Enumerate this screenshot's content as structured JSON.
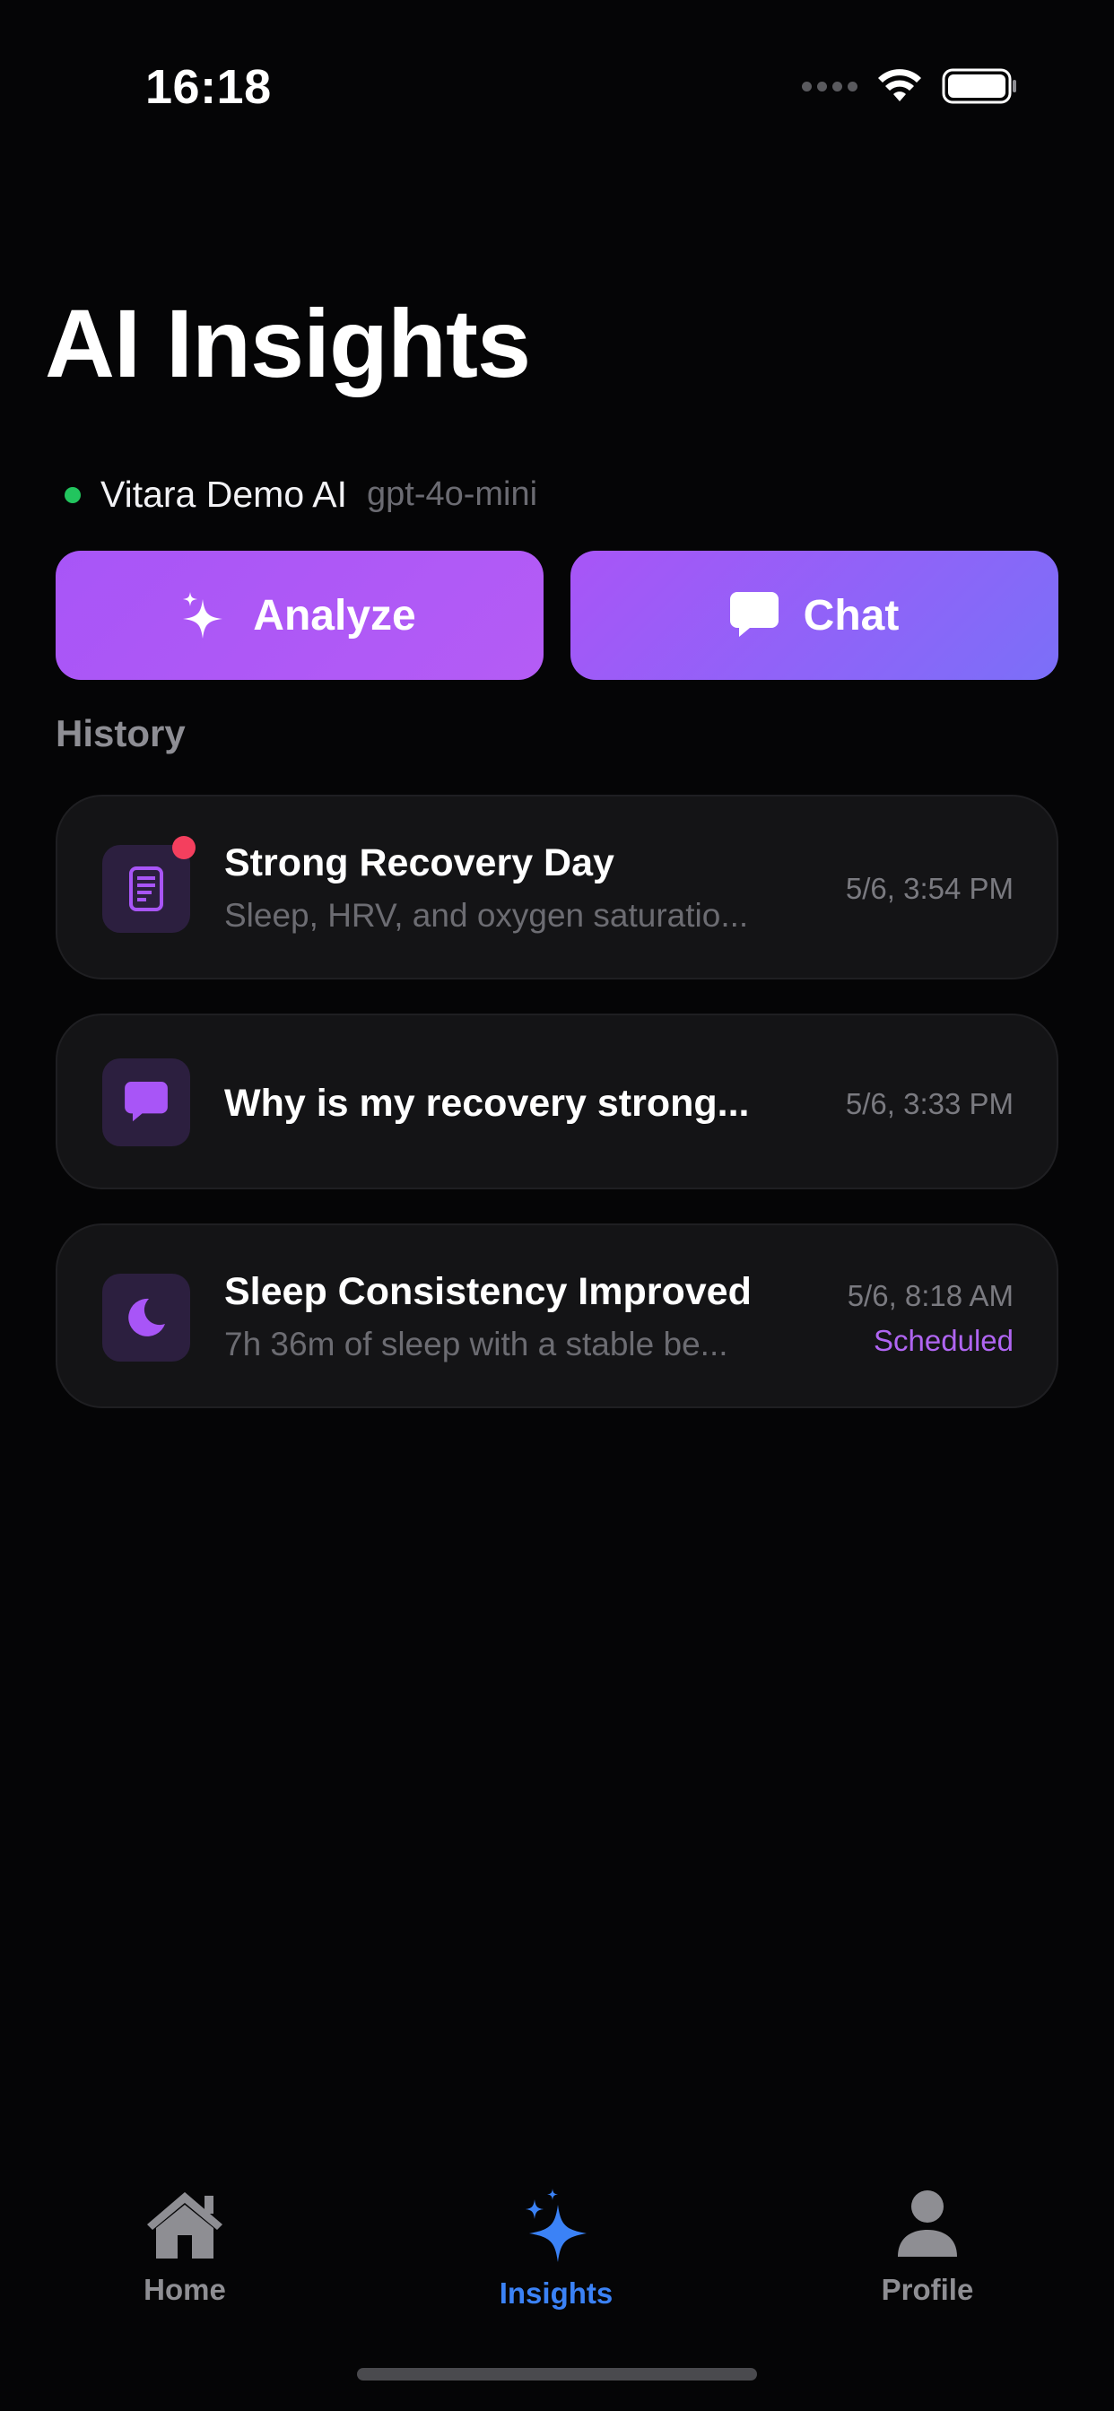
{
  "status_bar": {
    "time": "16:18"
  },
  "page": {
    "title": "AI Insights"
  },
  "model": {
    "name": "Vitara Demo AI",
    "id": "gpt-4o-mini",
    "status_color": "#22c55e"
  },
  "actions": {
    "analyze_label": "Analyze",
    "chat_label": "Chat"
  },
  "history": {
    "title": "History",
    "items": [
      {
        "icon": "report-icon",
        "title": "Strong Recovery Day",
        "subtitle": "Sleep, HRV, and oxygen saturatio...",
        "time": "5/6, 3:54 PM",
        "unread": true
      },
      {
        "icon": "chat-bubble-icon",
        "title": "Why is my recovery strong...",
        "time": "5/6, 3:33 PM"
      },
      {
        "icon": "moon-icon",
        "title": "Sleep Consistency Improved",
        "subtitle": "7h 36m of sleep with a stable be...",
        "time": "5/6, 8:18 AM",
        "badge": "Scheduled"
      }
    ]
  },
  "tab_bar": {
    "tabs": [
      {
        "label": "Home",
        "icon": "home-icon"
      },
      {
        "label": "Insights",
        "icon": "sparkles-icon",
        "active": true
      },
      {
        "label": "Profile",
        "icon": "person-icon"
      }
    ]
  },
  "colors": {
    "accent_purple": "#a855f7",
    "accent_blue": "#3b82f6",
    "background": "#050506",
    "card": "#141416"
  }
}
